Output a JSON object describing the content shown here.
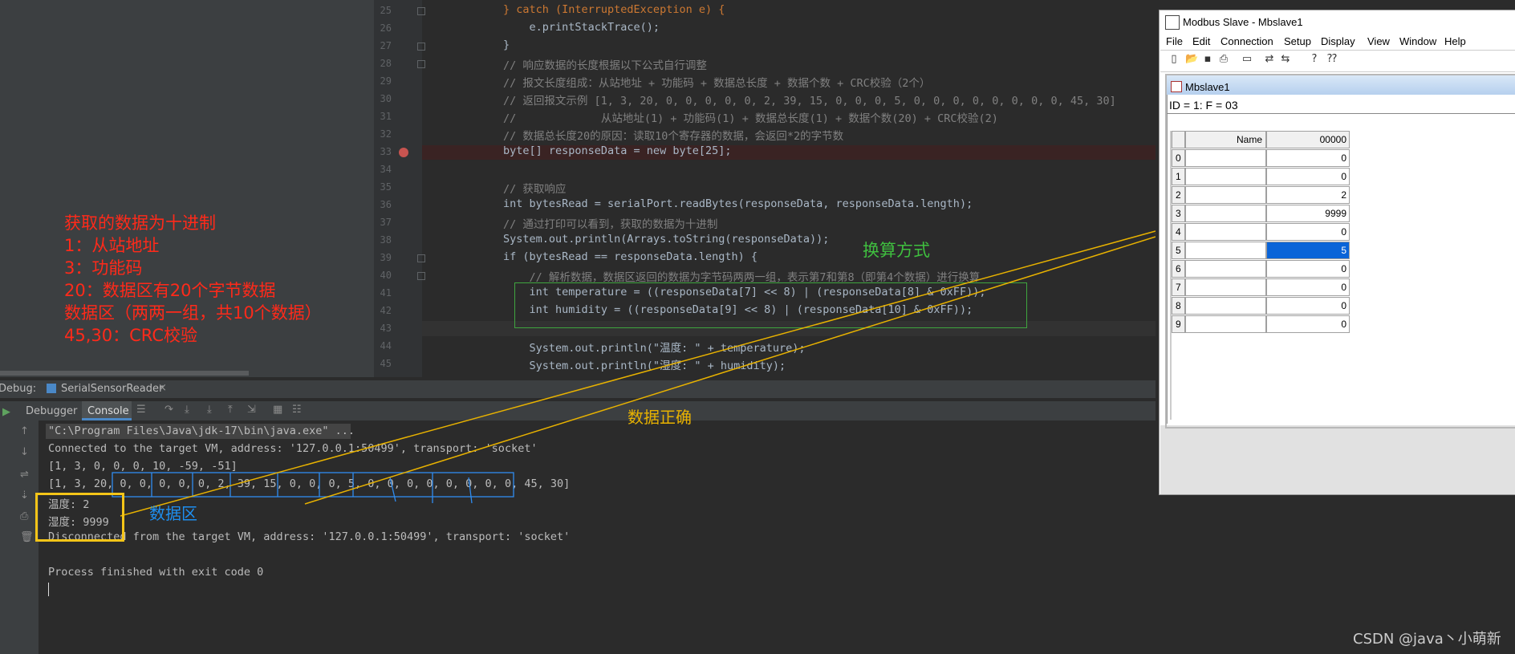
{
  "annotations": {
    "left_lines": [
      "获取的数据为十进制",
      "1：从站地址",
      "3：功能码",
      "20：数据区有20个字节数据",
      "数据区（两两一组，共10个数据）",
      "45,30：CRC校验"
    ],
    "conversion": "换算方式",
    "data_correct": "数据正确",
    "data_area": "数据区",
    "watermark": "CSDN @java丶小萌新"
  },
  "colors": {
    "red": "#ff2a1a",
    "green": "#3fa63f",
    "blue": "#1e8ff0",
    "orange": "#f5c518",
    "selection": "#0a64d8"
  },
  "editor": {
    "line_numbers": [
      "25",
      "26",
      "27",
      "28",
      "29",
      "30",
      "31",
      "32",
      "33",
      "34",
      "35",
      "36",
      "37",
      "38",
      "39",
      "40",
      "41",
      "42",
      "43",
      "44",
      "45"
    ],
    "lines": [
      "} catch (InterruptedException e) {",
      "    e.printStackTrace();",
      "}",
      "// 响应数据的长度根据以下公式自行调整",
      "// 报文长度组成：从站地址 + 功能码 + 数据总长度 + 数据个数 + CRC校验（2个）",
      "// 返回报文示例 [1, 3, 20, 0, 0, 0, 0, 0, 2, 39, 15, 0, 0, 0, 5, 0, 0, 0, 0, 0, 0, 0, 0, 45, 30]",
      "//             从站地址(1) + 功能码(1) + 数据总长度(1) + 数据个数(20) + CRC校验(2)",
      "// 数据总长度20的原因：读取10个寄存器的数据，会返回*2的字节数",
      "byte[] responseData = new byte[25];",
      "",
      "// 获取响应",
      "int bytesRead = serialPort.readBytes(responseData, responseData.length);",
      "// 通过打印可以看到，获取的数据为十进制",
      "System.out.println(Arrays.toString(responseData));",
      "if (bytesRead == responseData.length) {",
      "    // 解析数据，数据区返回的数据为字节码两两一组，表示第7和第8（即第4个数据）进行换算",
      "    int temperature = ((responseData[7] << 8) | (responseData[8] & 0xFF));",
      "    int humidity = ((responseData[9] << 8) | (responseData[10] & 0xFF));",
      "",
      "    System.out.println(\"温度: \" + temperature);",
      "    System.out.println(\"湿度: \" + humidity);"
    ]
  },
  "debug": {
    "label": "Debug:",
    "session_tab": "SerialSensorReader",
    "tabs": [
      "Debugger",
      "Console"
    ],
    "active_tab": "Console",
    "console_lines": [
      "\"C:\\Program Files\\Java\\jdk-17\\bin\\java.exe\" ...",
      "Connected to the target VM, address: '127.0.0.1:50499', transport: 'socket'",
      "[1, 3, 0, 0, 0, 10, -59, -51]",
      "[1, 3, 20, 0, 0, 0, 0, 0, 2, 39, 15, 0, 0, 0, 5, 0, 0, 0, 0, 0, 0, 0, 0, 45, 30]",
      "温度: 2",
      "湿度: 9999",
      "Disconnected from the target VM, address: '127.0.0.1:50499', transport: 'socket'",
      "",
      "Process finished with exit code 0"
    ]
  },
  "modbus": {
    "window_title": "Modbus Slave - Mbslave1",
    "menu": [
      "File",
      "Edit",
      "Connection",
      "Setup",
      "Display",
      "View",
      "Window",
      "Help"
    ],
    "toolbar_icons": [
      "new-icon",
      "open-icon",
      "save-icon",
      "print-icon",
      "window-icon",
      "connect-icon",
      "disconnect-icon",
      "help-icon",
      "context-help-icon"
    ],
    "doc_title": "Mbslave1",
    "status_line": "ID = 1: F = 03",
    "col_name": "Name",
    "col_addr": "00000",
    "rows": [
      {
        "idx": "0",
        "value": "0"
      },
      {
        "idx": "1",
        "value": "0"
      },
      {
        "idx": "2",
        "value": "2"
      },
      {
        "idx": "3",
        "value": "9999"
      },
      {
        "idx": "4",
        "value": "0"
      },
      {
        "idx": "5",
        "value": "5"
      },
      {
        "idx": "6",
        "value": "0"
      },
      {
        "idx": "7",
        "value": "0"
      },
      {
        "idx": "8",
        "value": "0"
      },
      {
        "idx": "9",
        "value": "0"
      }
    ],
    "selected_row": "5"
  }
}
